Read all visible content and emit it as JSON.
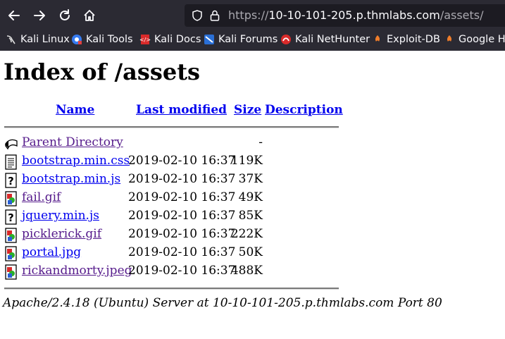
{
  "browser": {
    "url_prefix": "https://",
    "url_host": "10-10-101-205.p.thmlabs.com",
    "url_path": "/assets/",
    "bookmarks": [
      {
        "label": "Kali Linux",
        "icon": "kali-dragon-icon"
      },
      {
        "label": "Kali Tools",
        "icon": "kali-tools-icon"
      },
      {
        "label": "Kali Docs",
        "icon": "kali-docs-icon"
      },
      {
        "label": "Kali Forums",
        "icon": "kali-forums-icon"
      },
      {
        "label": "Kali NetHunter",
        "icon": "nethunter-icon"
      },
      {
        "label": "Exploit-DB",
        "icon": "exploit-db-icon"
      },
      {
        "label": "Google Ha",
        "icon": "google-hacking-icon"
      }
    ]
  },
  "page": {
    "title": "Index of /assets",
    "columns": {
      "name": "Name",
      "modified": "Last modified",
      "size": "Size",
      "description": "Description"
    },
    "parent": {
      "label": "Parent Directory",
      "size": "-"
    },
    "files": [
      {
        "name": "bootstrap.min.css",
        "modified": "2019-02-10 16:37",
        "size": "119K",
        "icon": "text-file-icon"
      },
      {
        "name": "bootstrap.min.js",
        "modified": "2019-02-10 16:37",
        "size": "37K",
        "icon": "unknown-file-icon"
      },
      {
        "name": "fail.gif",
        "modified": "2019-02-10 16:37",
        "size": "49K",
        "icon": "image-file-icon"
      },
      {
        "name": "jquery.min.js",
        "modified": "2019-02-10 16:37",
        "size": "85K",
        "icon": "unknown-file-icon"
      },
      {
        "name": "picklerick.gif",
        "modified": "2019-02-10 16:37",
        "size": "222K",
        "icon": "image-file-icon"
      },
      {
        "name": "portal.jpg",
        "modified": "2019-02-10 16:37",
        "size": "50K",
        "icon": "image-file-icon"
      },
      {
        "name": "rickandmorty.jpeg",
        "modified": "2019-02-10 16:37",
        "size": "488K",
        "icon": "image-file-icon"
      }
    ],
    "footer": "Apache/2.4.18 (Ubuntu) Server at 10-10-101-205.p.thmlabs.com Port 80"
  }
}
